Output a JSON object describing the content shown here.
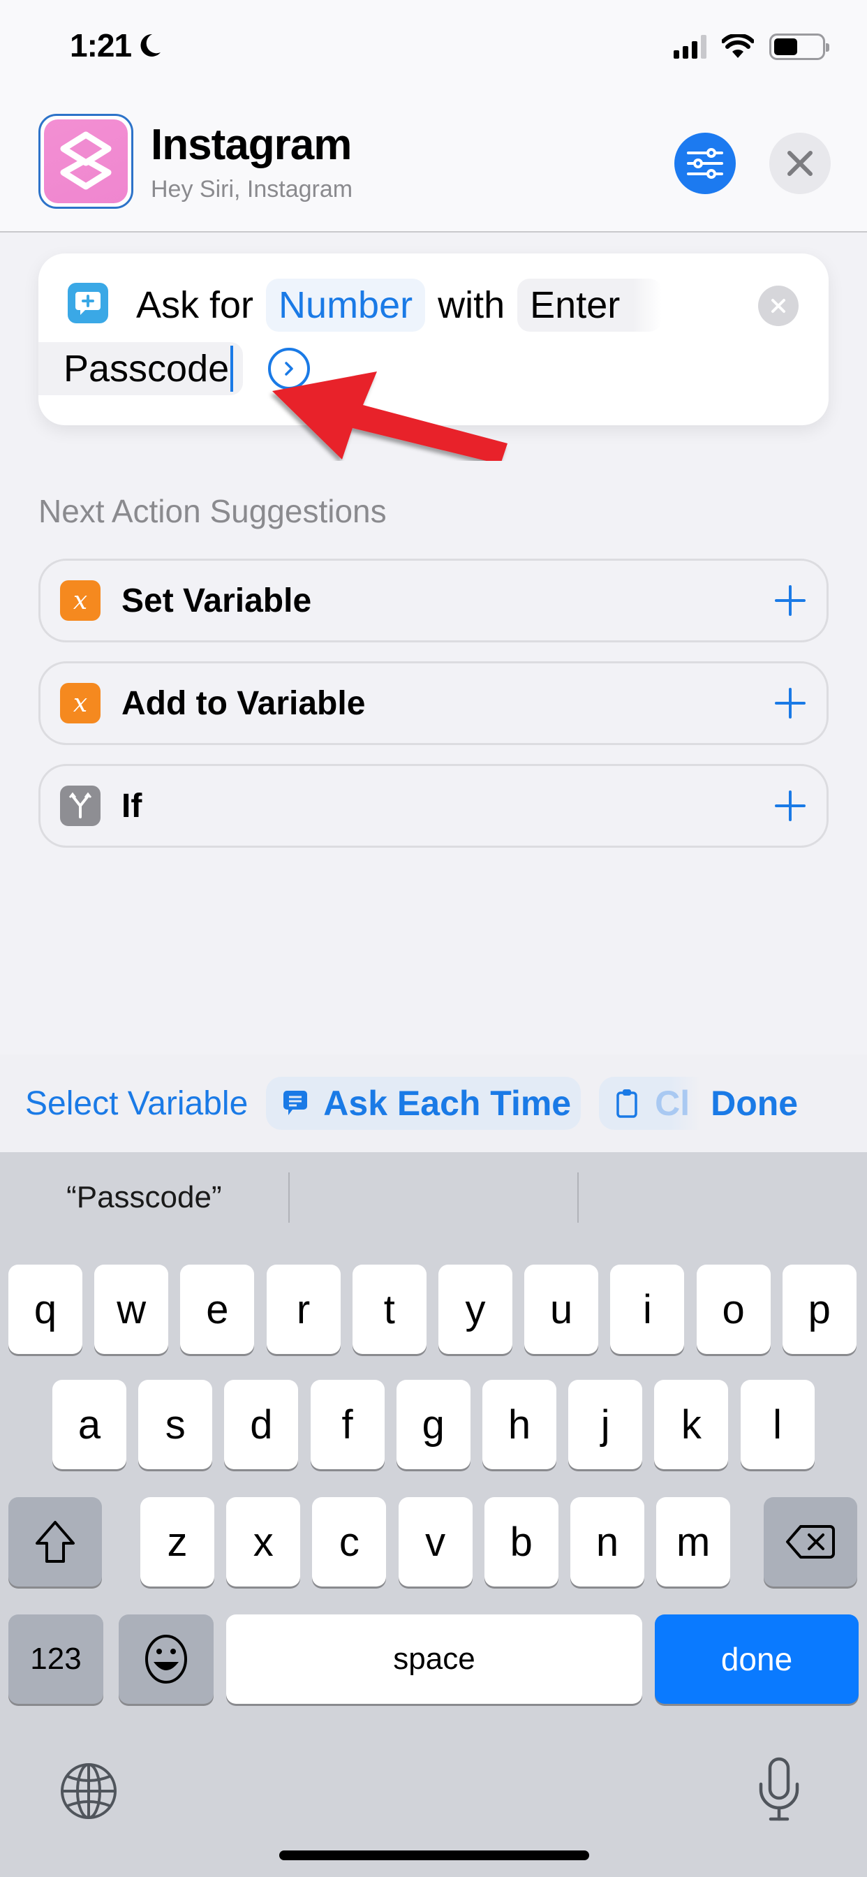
{
  "status_bar": {
    "time": "1:21",
    "focus_icon": "moon-icon",
    "signal_icon": "cellular-signal-icon",
    "wifi_icon": "wifi-icon",
    "battery_icon": "battery-icon",
    "battery_level": 0.5
  },
  "header": {
    "title": "Instagram",
    "subtitle": "Hey Siri, Instagram",
    "app_icon": "shortcuts-layers-icon",
    "settings_icon": "sliders-icon",
    "close_icon": "close-icon"
  },
  "action": {
    "icon": "ask-speech-bubble-plus-icon",
    "text_ask_for": "Ask for",
    "input_type": "Number",
    "text_with": "with",
    "prompt_part1": "Enter",
    "prompt_part2": "Passcode",
    "clear_icon": "clear-x-icon",
    "expand_icon": "chevron-right-circle-icon"
  },
  "annotation": {
    "type": "red-arrow",
    "color": "#e8202a"
  },
  "suggestions": {
    "header": "Next Action Suggestions",
    "items": [
      {
        "label": "Set Variable",
        "icon": "x",
        "icon_color": "#f5891f"
      },
      {
        "label": "Add to Variable",
        "icon": "x",
        "icon_color": "#f5891f"
      },
      {
        "label": "If",
        "icon": "branch",
        "icon_color": "#8e8e93"
      }
    ],
    "add_icon": "plus-icon"
  },
  "accessory_bar": {
    "select_variable": "Select Variable",
    "ask_each_time": "Ask Each Time",
    "clipboard_truncated": "Cl",
    "done": "Done"
  },
  "keyboard": {
    "predictions": [
      "“Passcode”",
      "",
      ""
    ],
    "row1": [
      "q",
      "w",
      "e",
      "r",
      "t",
      "y",
      "u",
      "i",
      "o",
      "p"
    ],
    "row2": [
      "a",
      "s",
      "d",
      "f",
      "g",
      "h",
      "j",
      "k",
      "l"
    ],
    "row3": [
      "z",
      "x",
      "c",
      "v",
      "b",
      "n",
      "m"
    ],
    "numbers_key": "123",
    "space_key": "space",
    "return_key": "done",
    "accent_color": "#0a7aff"
  }
}
